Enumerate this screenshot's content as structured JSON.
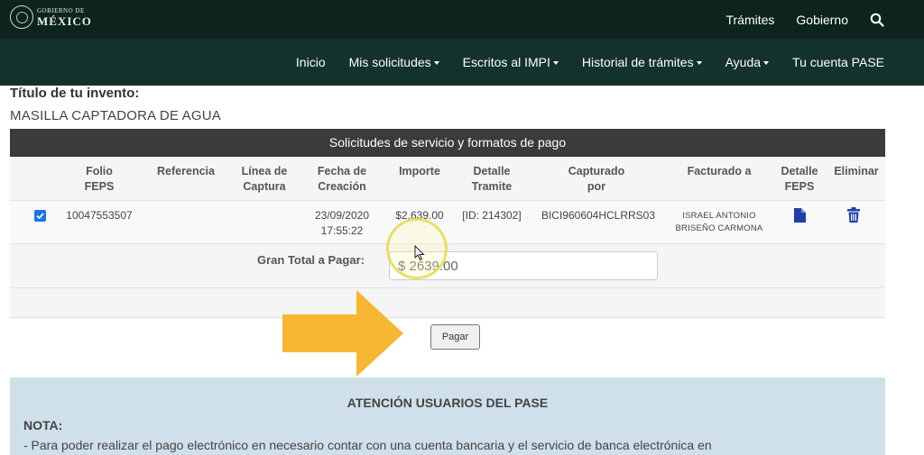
{
  "header": {
    "logo": {
      "small": "GOBIERNO DE",
      "big": "MÉXICO"
    },
    "links": [
      "Trámites",
      "Gobierno"
    ]
  },
  "nav": {
    "items": [
      {
        "label": "Inicio",
        "dropdown": false
      },
      {
        "label": "Mis solicitudes",
        "dropdown": true
      },
      {
        "label": "Escritos al IMPI",
        "dropdown": true
      },
      {
        "label": "Historial de trámites",
        "dropdown": true
      },
      {
        "label": "Ayuda",
        "dropdown": true
      },
      {
        "label": "Tu cuenta PASE",
        "dropdown": false
      }
    ]
  },
  "invention": {
    "title_label": "Título de tu invento:",
    "title_value": "MASILLA CAPTADORA DE AGUA"
  },
  "table": {
    "caption": "Solicitudes de servicio y formatos de pago",
    "headers": {
      "folio": [
        "Folio",
        "FEPS"
      ],
      "referencia": [
        "Referencia"
      ],
      "linea": [
        "Línea de",
        "Captura"
      ],
      "fecha": [
        "Fecha de",
        "Creación"
      ],
      "importe": [
        "Importe"
      ],
      "detalle_tramite": [
        "Detalle",
        "Tramite"
      ],
      "capturado": [
        "Capturado",
        "por"
      ],
      "facturado": [
        "Facturado a"
      ],
      "detalle_feps": [
        "Detalle",
        "FEPS"
      ],
      "eliminar": [
        "Eliminar"
      ]
    },
    "rows": [
      {
        "checked": true,
        "folio": "10047553507",
        "fecha": [
          "23/09/2020",
          "17:55:22"
        ],
        "importe": "$2,639.00",
        "detalle_tramite": "[ID: 214302]",
        "capturado": "BICI960604HCLRRS03",
        "facturado": [
          "ISRAEL ANTONIO",
          "BRISEÑO CARMONA"
        ]
      }
    ],
    "total_label": "Gran Total a Pagar:",
    "total_value": "$ 2639.00",
    "pay_button": "Pagar"
  },
  "notice": {
    "title": "ATENCIÓN USUARIOS DEL PASE",
    "nota_label": "NOTA:",
    "text": "- Para poder realizar el pago electrónico en necesario contar con una cuenta bancaria y el servicio de banca electrónica en"
  },
  "colors": {
    "topbar": "#0c231e",
    "navbar": "#13322b",
    "table_header": "#3b3b3b",
    "notice_bg": "#cfe0ea",
    "arrow": "#f7b733",
    "highlight": "#e6dc5a",
    "icon_blue": "#1f3fa8"
  },
  "icons": {
    "search": "search-icon",
    "detail": "document-icon",
    "delete": "trash-icon",
    "overlay_arrow": "arrow-right-icon"
  }
}
